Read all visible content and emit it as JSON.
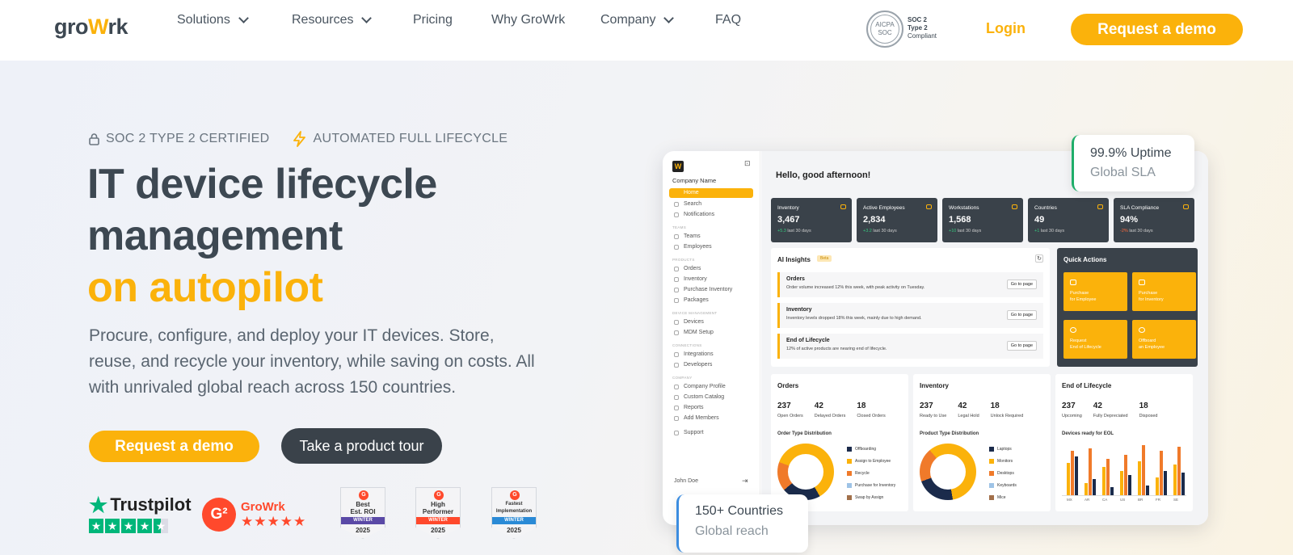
{
  "nav": {
    "logo_pre": "gro",
    "logo_w": "W",
    "logo_post": "rk",
    "items": [
      "Solutions",
      "Resources",
      "Pricing",
      "Why GroWrk",
      "Company",
      "FAQ"
    ],
    "soc_badge": {
      "line1": "AICPA",
      "line2": "SOC",
      "t1": "SOC 2",
      "t2": "Type 2",
      "t3": "Compliant"
    },
    "login": "Login",
    "demo": "Request a demo"
  },
  "hero": {
    "badge1": "SOC 2 TYPE 2 CERTIFIED",
    "badge2": "AUTOMATED FULL LIFECYCLE",
    "line1": "IT device lifecycle",
    "line2": "management",
    "line3": "on autopilot",
    "para": "Procure, configure, and deploy your IT devices. Store, reuse, and recycle your inventory, while saving on costs. All with unrivaled global reach across 150 countries.",
    "btn_demo": "Request a demo",
    "btn_tour": "Take a product tour",
    "trustpilot": "Trustpilot",
    "g2_name": "GroWrk",
    "awards": [
      {
        "title": "Best\nEst. ROI",
        "season": "WINTER",
        "year": "2025",
        "color": "#5a49a6"
      },
      {
        "title": "High\nPerformer",
        "season": "WINTER",
        "year": "2025",
        "color": "#ff492c"
      },
      {
        "title": "Fastest\nImplementation",
        "season": "WINTER",
        "year": "2025",
        "color": "#2a8ad6"
      }
    ]
  },
  "dashboard": {
    "company": "Company Name",
    "sidebar": {
      "home": "Home",
      "search": "Search",
      "notifications": "Notifications",
      "sec_teams": "TEAMS",
      "teams": "Teams",
      "employees": "Employees",
      "sec_products": "PRODUCTS",
      "orders": "Orders",
      "inventory": "Inventory",
      "purchase": "Purchase Inventory",
      "packages": "Packages",
      "sec_device": "DEVICE MANAGEMENT",
      "devices": "Devices",
      "mdm": "MDM Setup",
      "sec_conn": "CONNECTIONS",
      "integrations": "Integrations",
      "developers": "Developers",
      "sec_company": "COMPANY",
      "profile": "Company Profile",
      "catalog": "Custom Catalog",
      "reports": "Reports",
      "members": "Add Members",
      "support": "Support",
      "user": "John Doe"
    },
    "greeting": "Hello, good afternoon!",
    "stats": [
      {
        "label": "Inventory",
        "value": "3,467",
        "delta": "+5.3",
        "note": "last 30 days"
      },
      {
        "label": "Active Employees",
        "value": "2,834",
        "delta": "+3.2",
        "note": "last 30 days"
      },
      {
        "label": "Workstations",
        "value": "1,568",
        "delta": "+10",
        "note": "last 30 days"
      },
      {
        "label": "Countries",
        "value": "49",
        "delta": "+1",
        "note": "last 30 days"
      },
      {
        "label": "SLA Compliance",
        "value": "94%",
        "delta": "-2%",
        "note": "last 30 days"
      }
    ],
    "ai": {
      "title": "AI Insights",
      "beta": "Beta",
      "items": [
        {
          "head": "Orders",
          "body": "Order volume increased 12% this week, with peak activity on Tuesday.",
          "go": "Go to page"
        },
        {
          "head": "Inventory",
          "body": "Inventory levels dropped 18% this week, mainly due to high demand.",
          "go": "Go to page"
        },
        {
          "head": "End of Lifecycle",
          "body": "12% of active products are nearing end of lifecycle.",
          "go": "Go to page"
        }
      ]
    },
    "quick": {
      "title": "Quick Actions",
      "items": [
        "Purchase\nfor Employee",
        "Purchase\nfor Inventory",
        "Request\nEnd of Lifecycle",
        "Offboard\nan Employee"
      ]
    },
    "orders": {
      "title": "Orders",
      "n1": "237",
      "l1": "Open Orders",
      "n2": "42",
      "l2": "Delayed Orders",
      "n3": "18",
      "l3": "Closed Orders",
      "sub": "Order Type Distribution",
      "legend": [
        "Offboarding",
        "Assign to Employee",
        "Recycle",
        "Purchase for Inventory",
        "Swap by Assign"
      ]
    },
    "inventory": {
      "title": "Inventory",
      "n1": "237",
      "l1": "Ready to Use",
      "n2": "42",
      "l2": "Legal Hold",
      "n3": "18",
      "l3": "Unlock Required",
      "sub": "Product Type Distribution",
      "legend": [
        "Laptops",
        "Monitors",
        "Desktops",
        "Keyboards",
        "Mice"
      ]
    },
    "eol": {
      "title": "End of Lifecycle",
      "n1": "237",
      "l1": "Upcoming",
      "n2": "42",
      "l2": "Fully Depreciated",
      "n3": "18",
      "l3": "Disposed",
      "sub": "Devices ready for EOL",
      "x": [
        "MX",
        "AR",
        "CA",
        "US",
        "BR",
        "FR",
        "SE"
      ]
    }
  },
  "float": {
    "uptime_a": "99.9% Uptime",
    "uptime_b": "Global SLA",
    "countries_a": "150+ Countries",
    "countries_b": "Global reach"
  }
}
